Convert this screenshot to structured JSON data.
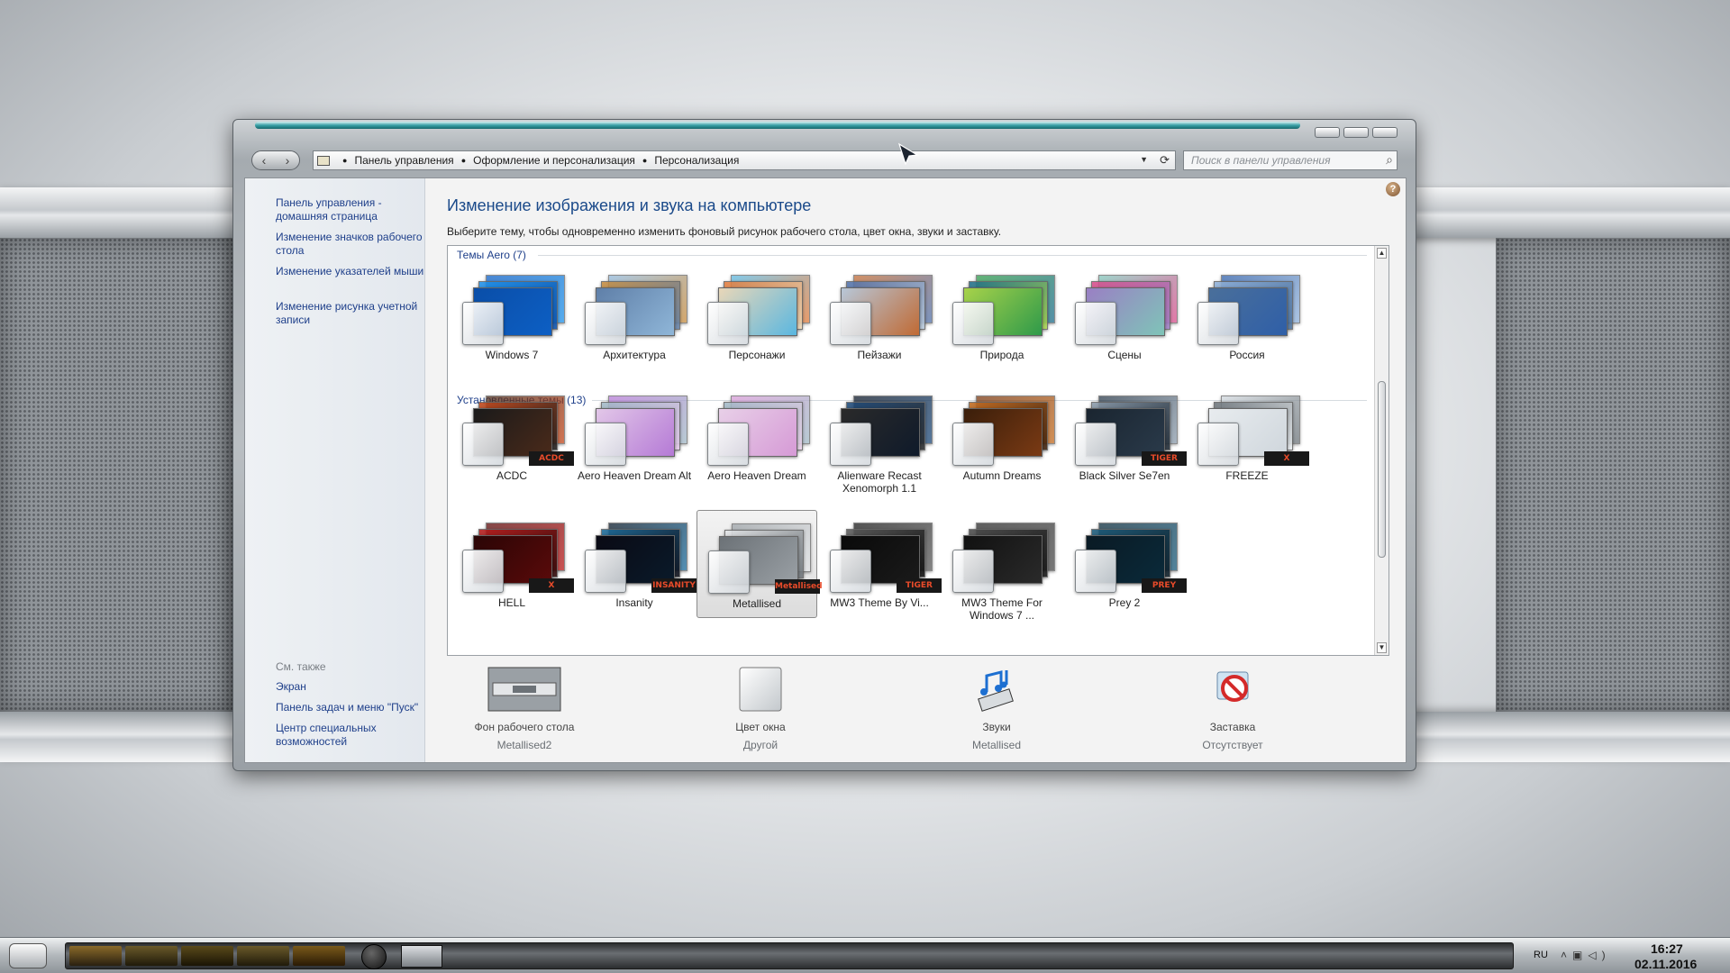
{
  "window": {
    "breadcrumb": [
      "Панель управления",
      "Оформление и персонализация",
      "Персонализация"
    ],
    "search_placeholder": "Поиск в панели управления"
  },
  "sidebar": {
    "top_links": [
      {
        "label": "Панель управления - домашняя страница"
      },
      {
        "label": "Изменение значков рабочего стола"
      },
      {
        "label": "Изменение указателей мыши"
      },
      {
        "label": "Изменение рисунка учетной записи"
      }
    ],
    "see_also_title": "См. также",
    "see_also": [
      {
        "label": "Экран"
      },
      {
        "label": "Панель задач и меню \"Пуск\""
      },
      {
        "label": "Центр специальных возможностей"
      }
    ]
  },
  "main": {
    "title": "Изменение изображения и звука на компьютере",
    "subtitle": "Выберите тему, чтобы одновременно изменить фоновый рисунок рабочего стола, цвет окна, звуки и заставку.",
    "groups": [
      {
        "header": "Темы Aero (7)",
        "themes": [
          {
            "label": "Windows 7",
            "colors": [
              "#0d5fc4",
              "#1e90e8",
              "#0a4ea8"
            ]
          },
          {
            "label": "Архитектура",
            "colors": [
              "#8fb6d8",
              "#c58a3c",
              "#5f7fa8"
            ]
          },
          {
            "label": "Персонажи",
            "colors": [
              "#5ab7e0",
              "#e07a3a",
              "#e9d7b8"
            ]
          },
          {
            "label": "Пейзажи",
            "colors": [
              "#c06a34",
              "#4f6fa8",
              "#b7c7d8"
            ]
          },
          {
            "label": "Природа",
            "colors": [
              "#2f9a4a",
              "#1d6b8a",
              "#a7d24a"
            ]
          },
          {
            "label": "Сцены",
            "colors": [
              "#7fc4b8",
              "#d84b8a",
              "#9a7fc4"
            ]
          },
          {
            "label": "Россия",
            "colors": [
              "#2f5fa8",
              "#8fb0d8",
              "#4a6f9a"
            ]
          }
        ]
      },
      {
        "header": "Установленные темы (13)",
        "themes": [
          {
            "label": "ACDC",
            "colors": [
              "#4a2a1a",
              "#c2461a",
              "#1a1a1a"
            ],
            "badge": "ACDC"
          },
          {
            "label": "Aero Heaven Dream Alt",
            "colors": [
              "#b57ad6",
              "#9fb7c4",
              "#e2c7e8"
            ]
          },
          {
            "label": "Aero Heaven Dream",
            "colors": [
              "#d69ad6",
              "#9fb7c4",
              "#e8d0e8"
            ]
          },
          {
            "label": "Alienware Recast Xenomorph 1.1",
            "colors": [
              "#0f1a2a",
              "#1e4a7a",
              "#2a2a2a"
            ]
          },
          {
            "label": "Autumn Dreams",
            "colors": [
              "#7a3a14",
              "#c26a1e",
              "#3a1e0a"
            ]
          },
          {
            "label": "Black Silver Se7en",
            "colors": [
              "#2a3a4a",
              "#8a9aaa",
              "#1a2530"
            ],
            "badge": "TIGER"
          },
          {
            "label": "FREEZE",
            "colors": [
              "#cfd6dc",
              "#6a7278",
              "#e8ecef"
            ],
            "badge": "X"
          },
          {
            "label": "HELL",
            "colors": [
              "#5a0a0a",
              "#b81a1a",
              "#2a0505"
            ],
            "badge": "X"
          },
          {
            "label": "Insanity",
            "colors": [
              "#0a1a2a",
              "#1a6a9a",
              "#0a0a14"
            ],
            "badge": "INSANITY"
          },
          {
            "label": "Metallised",
            "colors": [
              "#9aa0a5",
              "#e2e4e6",
              "#6c7277"
            ],
            "badge": "Metallised",
            "selected": true
          },
          {
            "label": "MW3 Theme By Vi...",
            "colors": [
              "#1a1a1a",
              "#5a5a5a",
              "#0a0a0a"
            ],
            "badge": "TIGER"
          },
          {
            "label": "MW3 Theme For Windows 7 ...",
            "colors": [
              "#2a2a2a",
              "#4a4a4a",
              "#111111"
            ]
          },
          {
            "label": "Prey 2",
            "colors": [
              "#0a2a3a",
              "#1a5a7a",
              "#0a1a24"
            ],
            "badge": "PREY"
          }
        ]
      }
    ],
    "settings": [
      {
        "name": "Фон рабочего стола",
        "value": "Metallised2",
        "icon": "desktop-background-icon"
      },
      {
        "name": "Цвет окна",
        "value": "Другой",
        "icon": "window-color-icon"
      },
      {
        "name": "Звуки",
        "value": "Metallised",
        "icon": "sounds-icon"
      },
      {
        "name": "Заставка",
        "value": "Отсутствует",
        "icon": "screensaver-icon"
      }
    ]
  },
  "taskbar": {
    "language": "RU",
    "time": "16:27",
    "date": "02.11.2016"
  }
}
